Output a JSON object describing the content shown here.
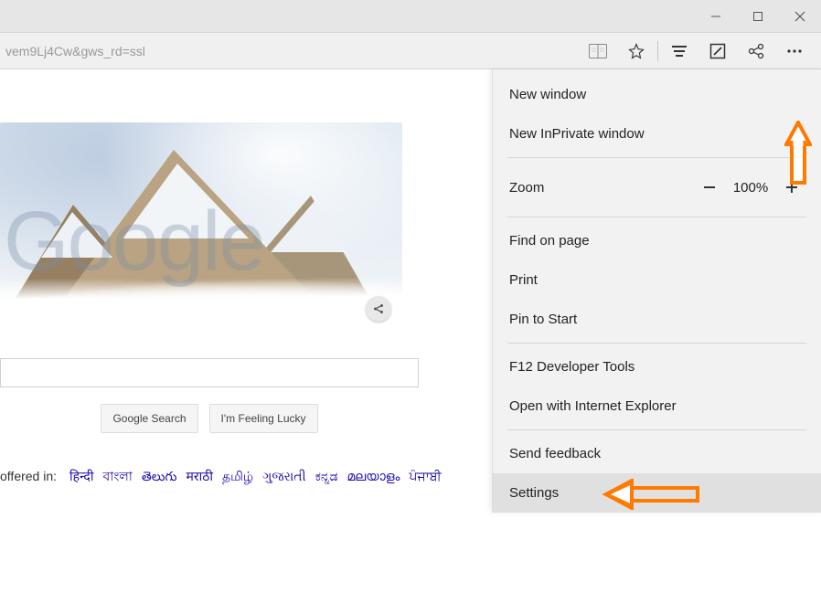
{
  "window": {
    "minimize_aria": "Minimize",
    "maximize_aria": "Maximize",
    "close_aria": "Close"
  },
  "addressbar": {
    "url_fragment": "vem9Lj4Cw&gws_rd=ssl"
  },
  "google": {
    "watermark": "Google",
    "search_btn": "Google Search",
    "lucky_btn": "I'm Feeling Lucky",
    "lang_lead": "offered in:",
    "languages": [
      "हिन्दी",
      "বাংলা",
      "తెలుగు",
      "मराठी",
      "தமிழ்",
      "ગુજરાતી",
      "ಕನ್ನಡ",
      "മലയാളം",
      "ਪੰਜਾਬੀ"
    ]
  },
  "menu": {
    "new_window": "New window",
    "new_inprivate": "New InPrivate window",
    "zoom_label": "Zoom",
    "zoom_value": "100%",
    "find": "Find on page",
    "print": "Print",
    "pin": "Pin to Start",
    "devtools": "F12 Developer Tools",
    "open_ie": "Open with Internet Explorer",
    "feedback": "Send feedback",
    "settings": "Settings"
  }
}
